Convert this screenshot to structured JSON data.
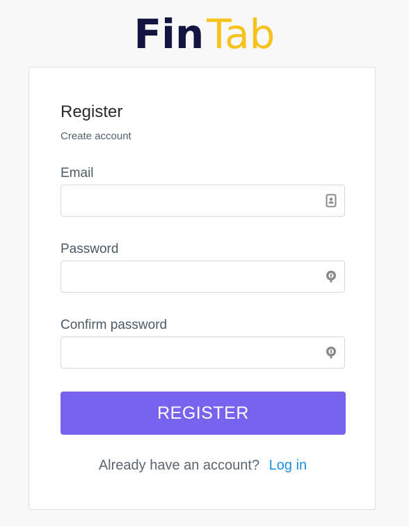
{
  "logo": {
    "part1": "Fin",
    "part2": "Tab"
  },
  "form": {
    "title": "Register",
    "subtitle": "Create account",
    "email": {
      "label": "Email",
      "value": "",
      "placeholder": "",
      "icon": "contact-card-icon"
    },
    "password": {
      "label": "Password",
      "value": "",
      "placeholder": "",
      "icon": "key-icon"
    },
    "confirm_password": {
      "label": "Confirm password",
      "value": "",
      "placeholder": "",
      "icon": "key-icon"
    },
    "submit_label": "REGISTER",
    "login_prompt": "Already have an account?",
    "login_link": "Log in"
  },
  "colors": {
    "brand_dark": "#141441",
    "brand_yellow": "#f6c21b",
    "button": "#7763ee",
    "link": "#1d8fe3"
  }
}
